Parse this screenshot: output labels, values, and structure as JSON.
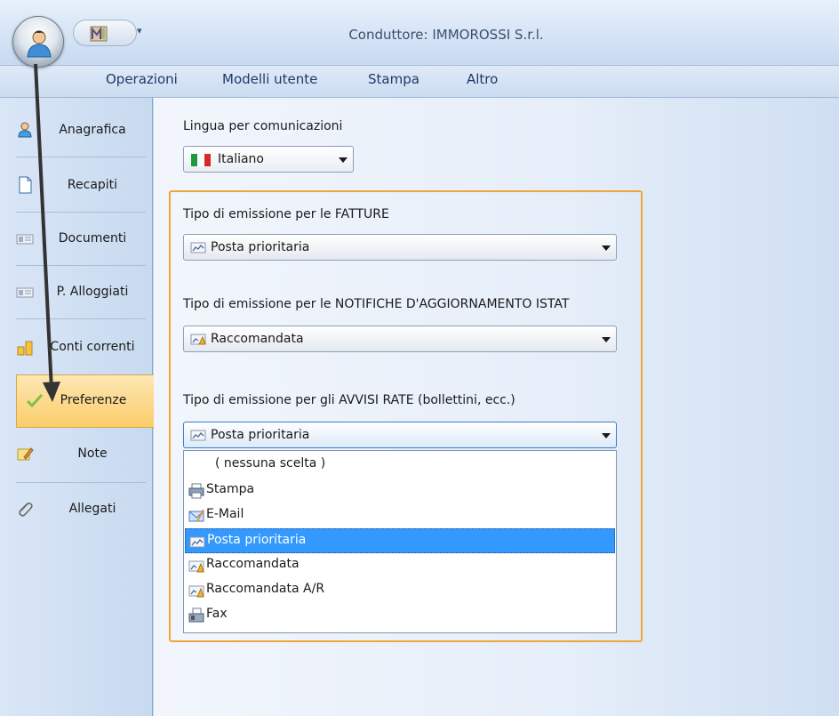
{
  "window": {
    "title": "Conduttore: IMMOROSSI S.r.l."
  },
  "quick_access": {
    "app_icon": "app-logo-icon",
    "dropdown_icon": "customize-arrow-icon"
  },
  "ribbon": {
    "tabs": [
      "Operazioni",
      "Modelli utente",
      "Stampa",
      "Altro"
    ]
  },
  "nav": {
    "items": [
      {
        "label": "Anagrafica",
        "icon": "person-card-icon"
      },
      {
        "label": "Recapiti",
        "icon": "document-icon"
      },
      {
        "label": "Documenti",
        "icon": "id-card-icon"
      },
      {
        "label": "P. Alloggiati",
        "icon": "id-card-icon"
      },
      {
        "label": "Conti correnti",
        "icon": "coins-icon"
      },
      {
        "label": "Preferenze",
        "icon": "checkmark-icon",
        "selected": true
      },
      {
        "label": "Note",
        "icon": "note-pencil-icon"
      },
      {
        "label": "Allegati",
        "icon": "paperclip-icon"
      }
    ]
  },
  "preferences": {
    "language_label": "Lingua per comunicazioni",
    "language_value": "Italiano",
    "fatture_label": "Tipo di emissione per le FATTURE",
    "fatture_value": "Posta prioritaria",
    "istat_label": "Tipo di emissione per le NOTIFICHE D'AGGIORNAMENTO ISTAT",
    "istat_value": "Raccomandata",
    "avvisi_label": "Tipo di emissione per gli AVVISI RATE (bollettini, ecc.)",
    "avvisi_value": "Posta prioritaria",
    "avvisi_options": [
      {
        "label": "( nessuna scelta )",
        "icon": ""
      },
      {
        "label": "Stampa",
        "icon": "printer-icon"
      },
      {
        "label": "E-Mail",
        "icon": "email-icon"
      },
      {
        "label": "Posta prioritaria",
        "icon": "priority-mail-icon",
        "highlighted": true
      },
      {
        "label": "Raccomandata",
        "icon": "registered-mail-icon"
      },
      {
        "label": "Raccomandata A/R",
        "icon": "registered-mail-icon"
      },
      {
        "label": "Fax",
        "icon": "fax-icon"
      }
    ]
  },
  "colors": {
    "accent_border": "#f0a53a",
    "selection": "#3399ff",
    "selected_nav": "#fbcd6a"
  }
}
